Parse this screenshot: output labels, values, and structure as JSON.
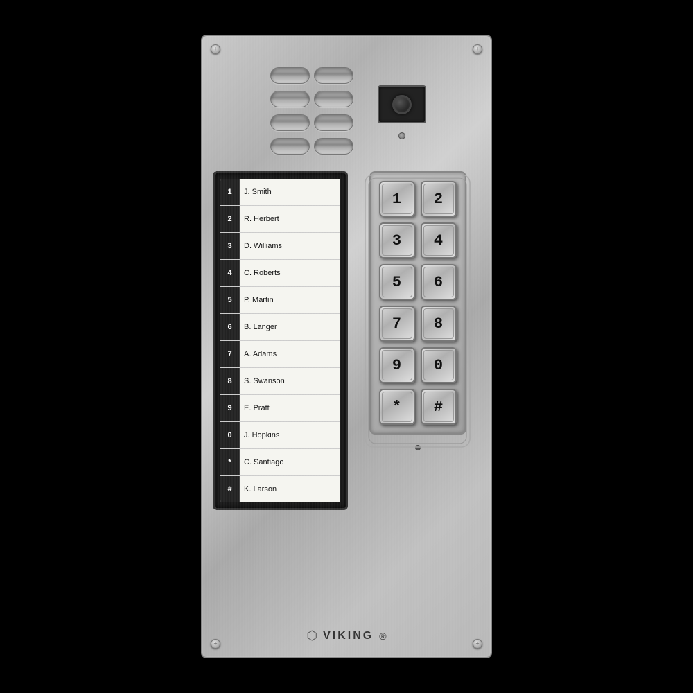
{
  "panel": {
    "brand": "VIKING",
    "brand_symbol": "®"
  },
  "speaker": {
    "slots": 8
  },
  "directory": {
    "entries": [
      {
        "key": "1",
        "name": "J. Smith"
      },
      {
        "key": "2",
        "name": "R. Herbert"
      },
      {
        "key": "3",
        "name": "D. Williams"
      },
      {
        "key": "4",
        "name": "C. Roberts"
      },
      {
        "key": "5",
        "name": "P. Martin"
      },
      {
        "key": "6",
        "name": "B. Langer"
      },
      {
        "key": "7",
        "name": "A. Adams"
      },
      {
        "key": "8",
        "name": "S. Swanson"
      },
      {
        "key": "9",
        "name": "E. Pratt"
      },
      {
        "key": "0",
        "name": "J. Hopkins"
      },
      {
        "key": "*",
        "name": "C. Santiago"
      },
      {
        "key": "#",
        "name": "K. Larson"
      }
    ]
  },
  "keypad": {
    "keys": [
      "1",
      "2",
      "3",
      "4",
      "5",
      "6",
      "7",
      "8",
      "9",
      "0",
      "*",
      "#"
    ]
  }
}
